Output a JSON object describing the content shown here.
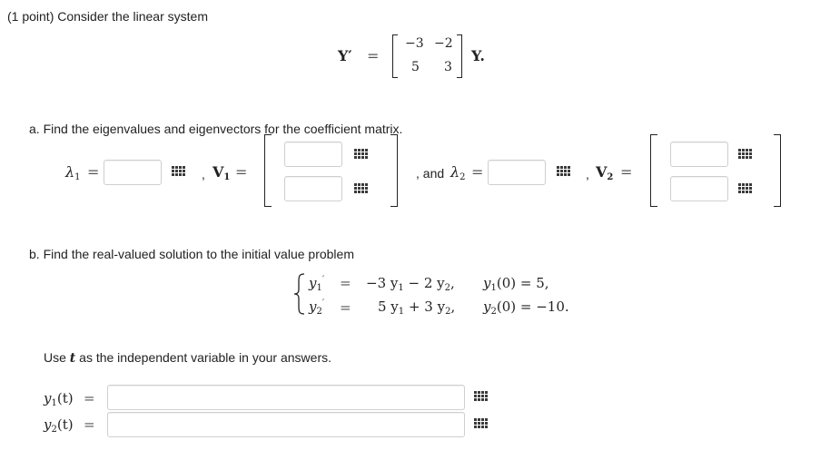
{
  "header": {
    "intro": "(1 point) Consider the linear system"
  },
  "system": {
    "lhs": "Y′",
    "equals": "=",
    "matrix": {
      "a11": "−3",
      "a12": "−2",
      "a21": "5",
      "a22": "3"
    },
    "rhs": "Y."
  },
  "part_a": {
    "prompt": "a. Find the eigenvalues and eigenvectors for the coefficient matrix.",
    "lambda_sym": "λ",
    "one": "1",
    "two": "2",
    "eq": "=",
    "v_sym": "V",
    "comma": ",",
    "and_text": ", and ",
    "lambda1_value": "",
    "v1_top": "",
    "v1_bottom": "",
    "lambda2_value": "",
    "v2_top": "",
    "v2_bottom": ""
  },
  "part_b": {
    "prompt": "b. Find the real-valued solution to the initial value problem",
    "eq1_lhs": "y",
    "eq1_rhs": "−3 y",
    "eq1_rhs_mid": " − 2 y",
    "eq1_tail": ",",
    "eq2_rhs": "5 y",
    "eq2_rhs_mid": " + 3 y",
    "ic1": "y",
    "ic1_rest": "(0) = 5,",
    "ic2_rest": "(0) = −10.",
    "instructions_pre": "Use ",
    "instructions_var": "t",
    "instructions_post": " as the independent variable in your answers.",
    "y1_label": "y",
    "t_arg": "(t)",
    "y1_value": "",
    "y2_value": ""
  },
  "icons": {
    "palette": "grid-palette-icon"
  }
}
